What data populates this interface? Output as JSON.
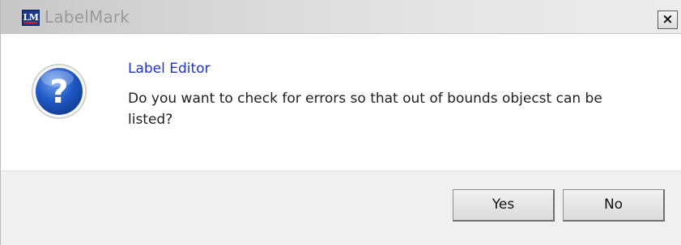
{
  "window": {
    "logo_text": "LM",
    "title": "LabelMark",
    "close_label": "×"
  },
  "dialog": {
    "icon": "question-icon",
    "heading": "Label Editor",
    "message": "Do you want to check for errors so that out of bounds objecst can be listed?"
  },
  "buttons": {
    "yes_label": "Yes",
    "no_label": "No"
  },
  "colors": {
    "heading": "#1f33c6",
    "icon_blue": "#1a4fb8",
    "footer_bg": "#f0f0f0"
  }
}
